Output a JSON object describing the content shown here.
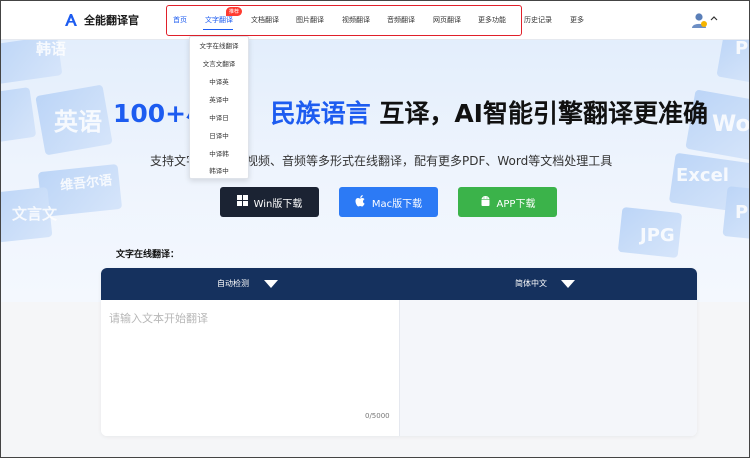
{
  "brand": {
    "name": "全能翻译官"
  },
  "nav": {
    "items": [
      {
        "label": "首页"
      },
      {
        "label": "文字翻译"
      },
      {
        "label": "文档翻译"
      },
      {
        "label": "图片翻译"
      },
      {
        "label": "视频翻译"
      },
      {
        "label": "音频翻译"
      },
      {
        "label": "网页翻译"
      },
      {
        "label": "更多功能"
      }
    ],
    "extra": [
      {
        "label": "历史记录"
      },
      {
        "label": "更多"
      }
    ],
    "badge": "推荐"
  },
  "dropdown": {
    "items": [
      "文字在线翻译",
      "文言文翻译",
      "中译英",
      "英译中",
      "中译日",
      "日译中",
      "中译韩",
      "韩译中"
    ]
  },
  "hero": {
    "headline_num": "100+",
    "headline_hidden": "小",
    "headline_blue": "民族语言",
    "headline_rest": "互译，AI智能引擎翻译更准确",
    "subline": "支持文字、图片、视频、音频等多形式在线翻译，配有更多PDF、Word等文档处理工具",
    "deco_words": [
      "英语",
      "韩语",
      "维吾尔语",
      "文言文",
      "Word",
      "Excel",
      "JPG",
      "P"
    ]
  },
  "downloads": {
    "win": "Win版下载",
    "mac": "Mac版下载",
    "app": "APP下载"
  },
  "translator": {
    "title": "文字在线翻译：",
    "source_lang": "自动检测",
    "target_lang": "简体中文",
    "placeholder": "请输入文本开始翻译",
    "count": "0/5000"
  },
  "colors": {
    "accent": "#1d5cf0",
    "nav_border": "#e0202a",
    "panel_bar": "#15315e",
    "win_btn": "#1b2333",
    "mac_btn": "#2c7af5",
    "app_btn": "#3bb34a"
  }
}
